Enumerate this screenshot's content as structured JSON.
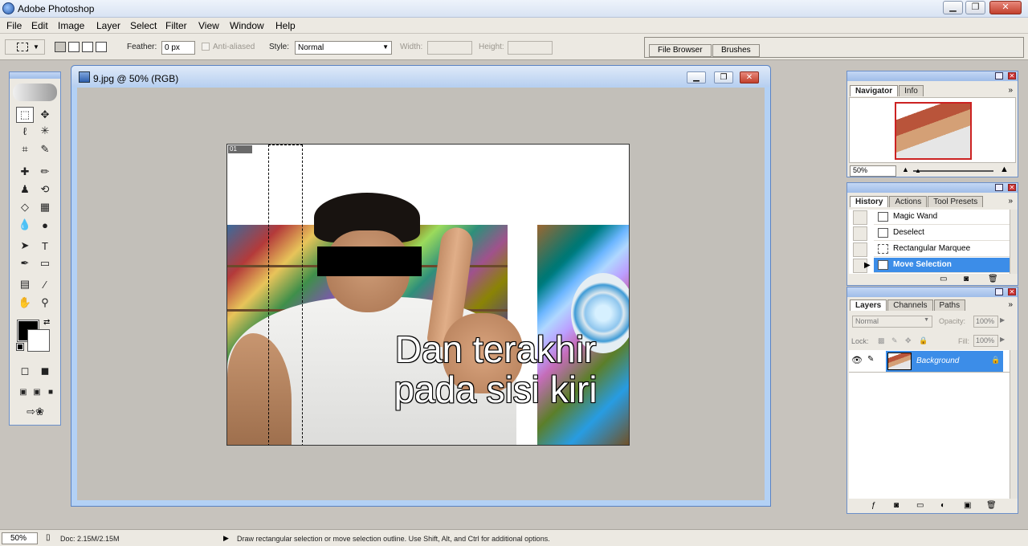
{
  "app": {
    "title": "Adobe Photoshop"
  },
  "window_buttons": {
    "minimize": "▁",
    "maximize": "❐",
    "close": "✕"
  },
  "menu": [
    "File",
    "Edit",
    "Image",
    "Layer",
    "Select",
    "Filter",
    "View",
    "Window",
    "Help"
  ],
  "options": {
    "feather_label": "Feather:",
    "feather_value": "0 px",
    "antialiased_label": "Anti-aliased",
    "style_label": "Style:",
    "style_value": "Normal",
    "width_label": "Width:",
    "height_label": "Height:",
    "palette_tabs": [
      "File Browser",
      "Brushes"
    ]
  },
  "document": {
    "title": "9.jpg @ 50% (RGB)",
    "slice_badge": "01",
    "caption_line1": "Dan terakhir",
    "caption_line2": "pada sisi kiri"
  },
  "navigator": {
    "tabs": [
      "Navigator",
      "Info"
    ],
    "zoom": "50%"
  },
  "history": {
    "tabs": [
      "History",
      "Actions",
      "Tool Presets"
    ],
    "items": [
      "Magic Wand",
      "Deselect",
      "Rectangular Marquee",
      "Move Selection"
    ],
    "selected_index": 3
  },
  "layers": {
    "tabs": [
      "Layers",
      "Channels",
      "Paths"
    ],
    "blend_mode": "Normal",
    "opacity_label": "Opacity:",
    "opacity": "100%",
    "lock_label": "Lock:",
    "fill_label": "Fill:",
    "fill": "100%",
    "layer_name": "Background"
  },
  "status": {
    "zoom": "50%",
    "doc": "Doc: 2.15M/2.15M",
    "hint": "Draw rectangular selection or move selection outline.  Use Shift, Alt, and Ctrl for additional options."
  },
  "colors": {
    "accent": "#3c8de8",
    "foreground": "#000000",
    "background": "#ffffff"
  }
}
